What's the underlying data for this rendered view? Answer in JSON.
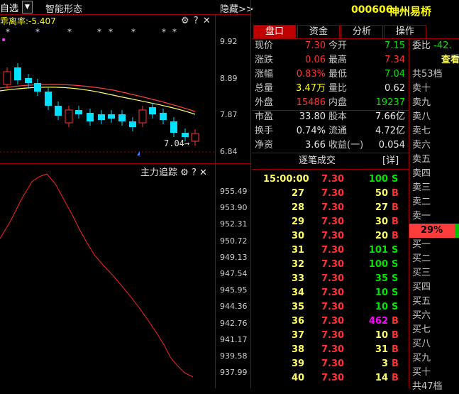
{
  "topbar": {
    "watchlist_label": "自选",
    "smart_pattern_label": "智能形态",
    "hide_label": "隐藏>>"
  },
  "upper_chart": {
    "indicator_label": "乖离率:-5.407",
    "y_ticks": [
      "9.92",
      "8.89",
      "7.87",
      "6.84"
    ],
    "last_price_annotation": "7.04",
    "stars": [
      "*",
      "*",
      "*",
      "*",
      "*",
      "*",
      "*",
      "*"
    ]
  },
  "lower_chart": {
    "title": "主力追踪",
    "y_ticks": [
      "955.49",
      "953.90",
      "952.31",
      "950.72",
      "949.13",
      "947.54",
      "945.95",
      "944.36",
      "942.76",
      "941.17",
      "939.58",
      "937.99"
    ]
  },
  "header": {
    "code": "000606",
    "name": "神州易桥"
  },
  "tabs": [
    {
      "label": "盘口",
      "active": true
    },
    {
      "label": "资金",
      "active": false
    },
    {
      "label": "分析",
      "active": false
    },
    {
      "label": "操作",
      "active": false
    }
  ],
  "quote": [
    {
      "l1": "现价",
      "v1": "7.30",
      "c1": "red",
      "l2": "今开",
      "v2": "7.15",
      "c2": "green"
    },
    {
      "l1": "涨跌",
      "v1": "0.06",
      "c1": "red",
      "l2": "最高",
      "v2": "7.34",
      "c2": "red"
    },
    {
      "l1": "涨幅",
      "v1": "0.83%",
      "c1": "red",
      "l2": "最低",
      "v2": "7.04",
      "c2": "green"
    },
    {
      "l1": "总量",
      "v1": "3.47万",
      "c1": "yellow",
      "l2": "量比",
      "v2": "0.62",
      "c2": "white"
    },
    {
      "l1": "外盘",
      "v1": "15486",
      "c1": "red",
      "l2": "内盘",
      "v2": "19237",
      "c2": "green"
    },
    {
      "l1": "市盈",
      "v1": "33.80",
      "c1": "white",
      "l2": "股本",
      "v2": "7.66亿",
      "c2": "white"
    },
    {
      "l1": "换手",
      "v1": "0.74%",
      "c1": "white",
      "l2": "流通",
      "v2": "4.72亿",
      "c2": "white"
    },
    {
      "l1": "净资",
      "v1": "3.66",
      "c1": "white",
      "l2": "收益(一)",
      "v2": "0.054",
      "c2": "white"
    }
  ],
  "ticks_panel": {
    "title": "逐笔成交",
    "detail_label": "[详]",
    "rows": [
      {
        "time": "15:00:00",
        "price": "7.30",
        "vol": "100",
        "side": "S"
      },
      {
        "time": "27",
        "price": "7.30",
        "vol": "50",
        "side": "B"
      },
      {
        "time": "28",
        "price": "7.30",
        "vol": "27",
        "side": "B"
      },
      {
        "time": "29",
        "price": "7.30",
        "vol": "30",
        "side": "B"
      },
      {
        "time": "30",
        "price": "7.30",
        "vol": "20",
        "side": "B"
      },
      {
        "time": "31",
        "price": "7.30",
        "vol": "101",
        "side": "S"
      },
      {
        "time": "32",
        "price": "7.30",
        "vol": "100",
        "side": "S"
      },
      {
        "time": "33",
        "price": "7.30",
        "vol": "35",
        "side": "S"
      },
      {
        "time": "34",
        "price": "7.30",
        "vol": "10",
        "side": "S"
      },
      {
        "time": "35",
        "price": "7.30",
        "vol": "10",
        "side": "S"
      },
      {
        "time": "36",
        "price": "7.30",
        "vol": "462",
        "side": "B"
      },
      {
        "time": "37",
        "price": "7.30",
        "vol": "10",
        "side": "B"
      },
      {
        "time": "38",
        "price": "7.30",
        "vol": "31",
        "side": "B"
      },
      {
        "time": "39",
        "price": "7.30",
        "vol": "3",
        "side": "B"
      },
      {
        "time": "40",
        "price": "7.30",
        "vol": "14",
        "side": "B"
      }
    ]
  },
  "order_book": {
    "weibi_label": "委比",
    "weibi_value": "-42.",
    "view_label": "查看",
    "total_sell": "共53档",
    "sells": [
      "卖十",
      "卖九",
      "卖八",
      "卖七",
      "卖六",
      "卖五",
      "卖四",
      "卖三",
      "卖二",
      "卖一"
    ],
    "ratio": "29%",
    "ratio_fraction": 0.29,
    "buys": [
      "买一",
      "买二",
      "买三",
      "买四",
      "买五",
      "买六",
      "买七",
      "买八",
      "买九",
      "买十"
    ],
    "total_buy": "共47档"
  },
  "colors": {
    "red": "#ff3232",
    "green": "#00e600",
    "yellow": "#ffff00",
    "border": "#9b0000",
    "purple": "#ff00ff"
  }
}
